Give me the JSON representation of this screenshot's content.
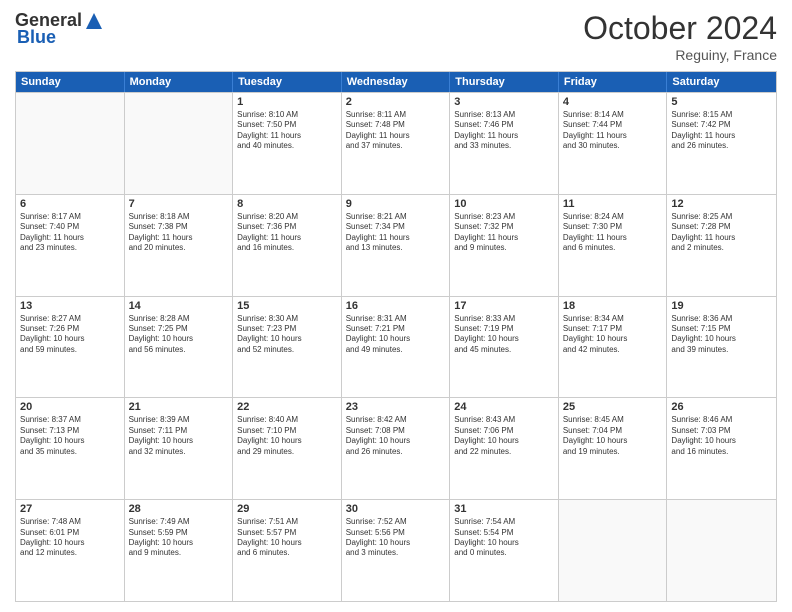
{
  "header": {
    "logo_general": "General",
    "logo_blue": "Blue",
    "month_title": "October 2024",
    "subtitle": "Reguiny, France"
  },
  "days_of_week": [
    "Sunday",
    "Monday",
    "Tuesday",
    "Wednesday",
    "Thursday",
    "Friday",
    "Saturday"
  ],
  "weeks": [
    [
      {
        "day": "",
        "empty": true
      },
      {
        "day": "",
        "empty": true
      },
      {
        "day": "1",
        "lines": [
          "Sunrise: 8:10 AM",
          "Sunset: 7:50 PM",
          "Daylight: 11 hours",
          "and 40 minutes."
        ]
      },
      {
        "day": "2",
        "lines": [
          "Sunrise: 8:11 AM",
          "Sunset: 7:48 PM",
          "Daylight: 11 hours",
          "and 37 minutes."
        ]
      },
      {
        "day": "3",
        "lines": [
          "Sunrise: 8:13 AM",
          "Sunset: 7:46 PM",
          "Daylight: 11 hours",
          "and 33 minutes."
        ]
      },
      {
        "day": "4",
        "lines": [
          "Sunrise: 8:14 AM",
          "Sunset: 7:44 PM",
          "Daylight: 11 hours",
          "and 30 minutes."
        ]
      },
      {
        "day": "5",
        "lines": [
          "Sunrise: 8:15 AM",
          "Sunset: 7:42 PM",
          "Daylight: 11 hours",
          "and 26 minutes."
        ]
      }
    ],
    [
      {
        "day": "6",
        "lines": [
          "Sunrise: 8:17 AM",
          "Sunset: 7:40 PM",
          "Daylight: 11 hours",
          "and 23 minutes."
        ]
      },
      {
        "day": "7",
        "lines": [
          "Sunrise: 8:18 AM",
          "Sunset: 7:38 PM",
          "Daylight: 11 hours",
          "and 20 minutes."
        ]
      },
      {
        "day": "8",
        "lines": [
          "Sunrise: 8:20 AM",
          "Sunset: 7:36 PM",
          "Daylight: 11 hours",
          "and 16 minutes."
        ]
      },
      {
        "day": "9",
        "lines": [
          "Sunrise: 8:21 AM",
          "Sunset: 7:34 PM",
          "Daylight: 11 hours",
          "and 13 minutes."
        ]
      },
      {
        "day": "10",
        "lines": [
          "Sunrise: 8:23 AM",
          "Sunset: 7:32 PM",
          "Daylight: 11 hours",
          "and 9 minutes."
        ]
      },
      {
        "day": "11",
        "lines": [
          "Sunrise: 8:24 AM",
          "Sunset: 7:30 PM",
          "Daylight: 11 hours",
          "and 6 minutes."
        ]
      },
      {
        "day": "12",
        "lines": [
          "Sunrise: 8:25 AM",
          "Sunset: 7:28 PM",
          "Daylight: 11 hours",
          "and 2 minutes."
        ]
      }
    ],
    [
      {
        "day": "13",
        "lines": [
          "Sunrise: 8:27 AM",
          "Sunset: 7:26 PM",
          "Daylight: 10 hours",
          "and 59 minutes."
        ]
      },
      {
        "day": "14",
        "lines": [
          "Sunrise: 8:28 AM",
          "Sunset: 7:25 PM",
          "Daylight: 10 hours",
          "and 56 minutes."
        ]
      },
      {
        "day": "15",
        "lines": [
          "Sunrise: 8:30 AM",
          "Sunset: 7:23 PM",
          "Daylight: 10 hours",
          "and 52 minutes."
        ]
      },
      {
        "day": "16",
        "lines": [
          "Sunrise: 8:31 AM",
          "Sunset: 7:21 PM",
          "Daylight: 10 hours",
          "and 49 minutes."
        ]
      },
      {
        "day": "17",
        "lines": [
          "Sunrise: 8:33 AM",
          "Sunset: 7:19 PM",
          "Daylight: 10 hours",
          "and 45 minutes."
        ]
      },
      {
        "day": "18",
        "lines": [
          "Sunrise: 8:34 AM",
          "Sunset: 7:17 PM",
          "Daylight: 10 hours",
          "and 42 minutes."
        ]
      },
      {
        "day": "19",
        "lines": [
          "Sunrise: 8:36 AM",
          "Sunset: 7:15 PM",
          "Daylight: 10 hours",
          "and 39 minutes."
        ]
      }
    ],
    [
      {
        "day": "20",
        "lines": [
          "Sunrise: 8:37 AM",
          "Sunset: 7:13 PM",
          "Daylight: 10 hours",
          "and 35 minutes."
        ]
      },
      {
        "day": "21",
        "lines": [
          "Sunrise: 8:39 AM",
          "Sunset: 7:11 PM",
          "Daylight: 10 hours",
          "and 32 minutes."
        ]
      },
      {
        "day": "22",
        "lines": [
          "Sunrise: 8:40 AM",
          "Sunset: 7:10 PM",
          "Daylight: 10 hours",
          "and 29 minutes."
        ]
      },
      {
        "day": "23",
        "lines": [
          "Sunrise: 8:42 AM",
          "Sunset: 7:08 PM",
          "Daylight: 10 hours",
          "and 26 minutes."
        ]
      },
      {
        "day": "24",
        "lines": [
          "Sunrise: 8:43 AM",
          "Sunset: 7:06 PM",
          "Daylight: 10 hours",
          "and 22 minutes."
        ]
      },
      {
        "day": "25",
        "lines": [
          "Sunrise: 8:45 AM",
          "Sunset: 7:04 PM",
          "Daylight: 10 hours",
          "and 19 minutes."
        ]
      },
      {
        "day": "26",
        "lines": [
          "Sunrise: 8:46 AM",
          "Sunset: 7:03 PM",
          "Daylight: 10 hours",
          "and 16 minutes."
        ]
      }
    ],
    [
      {
        "day": "27",
        "lines": [
          "Sunrise: 7:48 AM",
          "Sunset: 6:01 PM",
          "Daylight: 10 hours",
          "and 12 minutes."
        ]
      },
      {
        "day": "28",
        "lines": [
          "Sunrise: 7:49 AM",
          "Sunset: 5:59 PM",
          "Daylight: 10 hours",
          "and 9 minutes."
        ]
      },
      {
        "day": "29",
        "lines": [
          "Sunrise: 7:51 AM",
          "Sunset: 5:57 PM",
          "Daylight: 10 hours",
          "and 6 minutes."
        ]
      },
      {
        "day": "30",
        "lines": [
          "Sunrise: 7:52 AM",
          "Sunset: 5:56 PM",
          "Daylight: 10 hours",
          "and 3 minutes."
        ]
      },
      {
        "day": "31",
        "lines": [
          "Sunrise: 7:54 AM",
          "Sunset: 5:54 PM",
          "Daylight: 10 hours",
          "and 0 minutes."
        ]
      },
      {
        "day": "",
        "empty": true
      },
      {
        "day": "",
        "empty": true
      }
    ]
  ]
}
